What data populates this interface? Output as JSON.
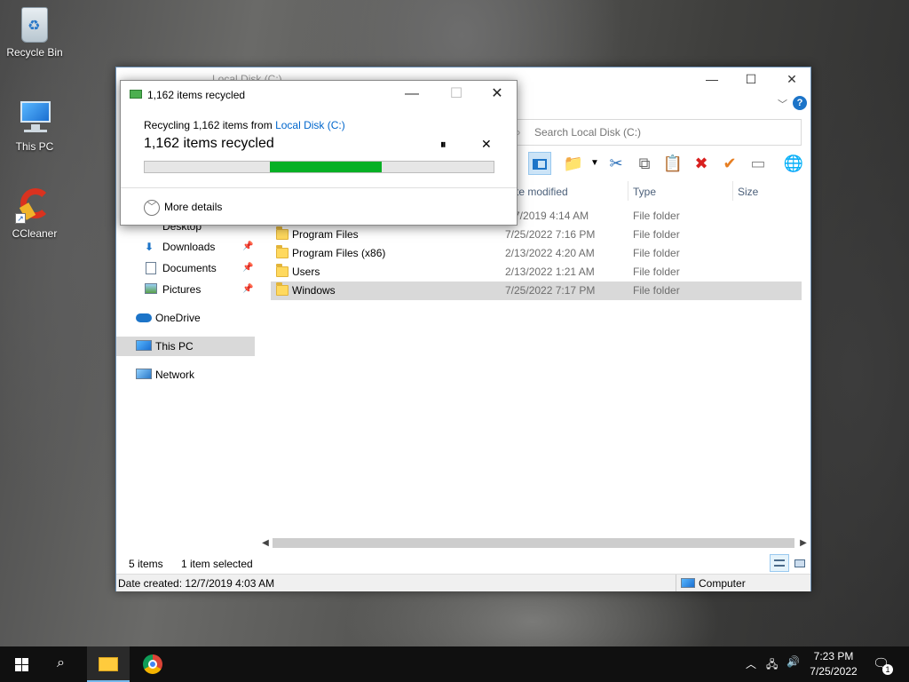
{
  "desktop": {
    "icons": [
      {
        "label": "Recycle Bin"
      },
      {
        "label": "This PC"
      },
      {
        "label": "CCleaner"
      }
    ]
  },
  "explorer": {
    "title": "Local Disk (C:)",
    "search_placeholder": "Search Local Disk (C:)",
    "columns": {
      "date": "te modified",
      "type": "Type",
      "size": "Size"
    },
    "nav": [
      {
        "label": "Desktop",
        "pinned": true
      },
      {
        "label": "Downloads",
        "pinned": true
      },
      {
        "label": "Documents",
        "pinned": true
      },
      {
        "label": "Pictures",
        "pinned": true
      },
      {
        "label": "OneDrive"
      },
      {
        "label": "This PC",
        "selected": true
      },
      {
        "label": "Network"
      }
    ],
    "files": [
      {
        "name": "",
        "date": "7/7/2019 4:14 AM",
        "type": "File folder"
      },
      {
        "name": "Program Files",
        "date": "7/25/2022 7:16 PM",
        "type": "File folder"
      },
      {
        "name": "Program Files (x86)",
        "date": "2/13/2022 4:20 AM",
        "type": "File folder"
      },
      {
        "name": "Users",
        "date": "2/13/2022 1:21 AM",
        "type": "File folder"
      },
      {
        "name": "Windows",
        "date": "7/25/2022 7:17 PM",
        "type": "File folder",
        "selected": true
      }
    ],
    "status": {
      "items": "5 items",
      "selected": "1 item selected"
    },
    "bottom": {
      "date_created": "Date created: 12/7/2019 4:03 AM",
      "computer": "Computer"
    }
  },
  "dialog": {
    "title": "1,162 items recycled",
    "subtitle_prefix": "Recycling 1,162 items from ",
    "subtitle_link": "Local Disk (C:)",
    "main_text": "1,162 items recycled",
    "progress_fraction": 0.32,
    "progress_start_fraction": 0.36,
    "more_details": "More details"
  },
  "taskbar": {
    "time": "7:23 PM",
    "date": "7/25/2022",
    "notification_count": "1"
  },
  "colors": {
    "progress_green": "#06b025",
    "accent_blue": "#0078d7",
    "taskbar_bg": "#101010"
  }
}
